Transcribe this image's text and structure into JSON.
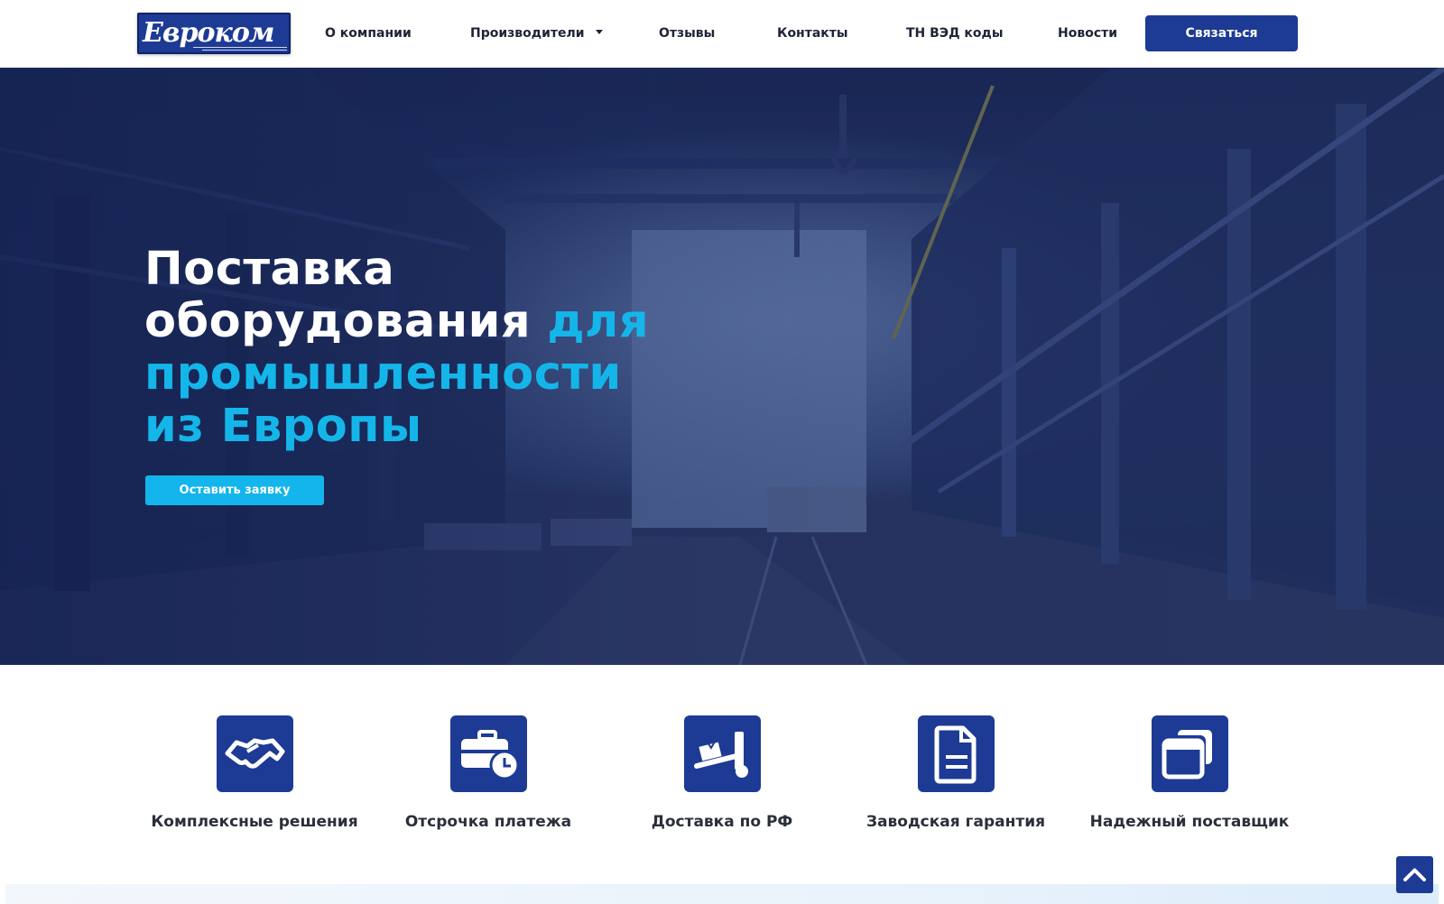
{
  "logo": {
    "text": "Евроком"
  },
  "nav": {
    "items": [
      {
        "label": "О компании"
      },
      {
        "label": "Производители",
        "has_dropdown": true
      },
      {
        "label": "Отзывы"
      },
      {
        "label": "Контакты"
      },
      {
        "label": "ТН ВЭД коды"
      },
      {
        "label": "Новости"
      }
    ],
    "contact_button": "Связаться"
  },
  "hero": {
    "title_white": "Поставка оборудования",
    "title_accent": "для промышленности из Европы",
    "cta_label": "Оставить заявку"
  },
  "features": [
    {
      "label": "Комплексные решения",
      "icon": "handshake-icon"
    },
    {
      "label": "Отсрочка платежа",
      "icon": "briefcase-clock-icon"
    },
    {
      "label": "Доставка по РФ",
      "icon": "dolly-icon"
    },
    {
      "label": "Заводская гарантия",
      "icon": "document-icon"
    },
    {
      "label": "Надежный поставщик",
      "icon": "copy-icon"
    }
  ],
  "colors": {
    "brand": "#1d3a94",
    "accent": "#14b6ea",
    "text": "#1e2436"
  }
}
